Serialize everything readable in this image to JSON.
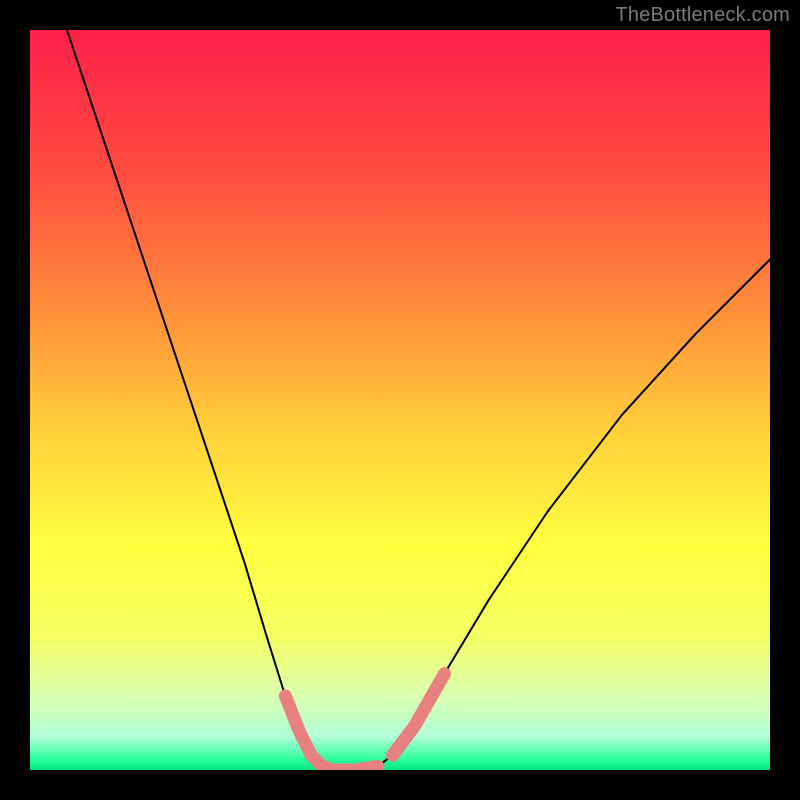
{
  "watermark": "TheBottleneck.com",
  "chart_data": {
    "type": "line",
    "title": "",
    "xlabel": "",
    "ylabel": "",
    "xlim": [
      0,
      100
    ],
    "ylim": [
      0,
      100
    ],
    "grid": false,
    "legend": false,
    "background_gradient": {
      "stops": [
        {
          "pos": 0.0,
          "color": "#ff1f4b"
        },
        {
          "pos": 0.2,
          "color": "#ff4e3f"
        },
        {
          "pos": 0.4,
          "color": "#ff963a"
        },
        {
          "pos": 0.55,
          "color": "#ffd23a"
        },
        {
          "pos": 0.7,
          "color": "#ffff3f"
        },
        {
          "pos": 0.82,
          "color": "#f4ff64"
        },
        {
          "pos": 0.9,
          "color": "#d9ffb0"
        },
        {
          "pos": 0.955,
          "color": "#b1ffd8"
        },
        {
          "pos": 0.985,
          "color": "#2fff9f"
        },
        {
          "pos": 1.0,
          "color": "#00e87a"
        }
      ]
    },
    "series": [
      {
        "name": "bottleneck-curve",
        "x": [
          5,
          9,
          13,
          17,
          21,
          25,
          29,
          32,
          34.5,
          36.5,
          38,
          39.5,
          41,
          44,
          47,
          49,
          52,
          56,
          62,
          70,
          80,
          90,
          100
        ],
        "y": [
          100,
          88,
          76,
          64,
          52,
          40,
          28,
          18,
          10,
          5,
          2,
          0.5,
          0,
          0,
          0.5,
          2,
          6,
          13,
          23,
          35,
          48,
          59,
          69
        ]
      }
    ],
    "highlight_segments": [
      {
        "name": "left-descent-highlight",
        "x": [
          34.5,
          36.5,
          38,
          39.5,
          41
        ],
        "y": [
          10,
          5,
          2,
          0.5,
          0
        ]
      },
      {
        "name": "valley-floor-highlight",
        "x": [
          41,
          44,
          47
        ],
        "y": [
          0,
          0,
          0.5
        ]
      },
      {
        "name": "right-ascent-highlight",
        "x": [
          49,
          52,
          56
        ],
        "y": [
          2,
          6,
          13
        ]
      }
    ]
  }
}
